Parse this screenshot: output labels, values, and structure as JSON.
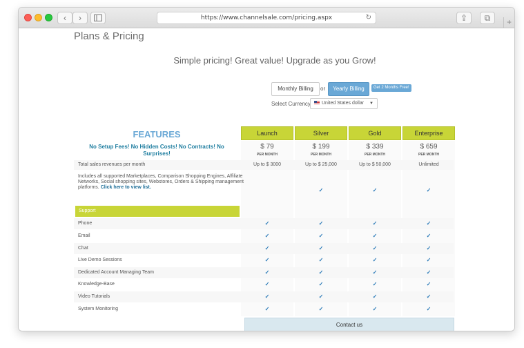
{
  "browser": {
    "url": "https://www.channelsale.com/pricing.aspx",
    "back_glyph": "‹",
    "forward_glyph": "›",
    "reload_glyph": "↻",
    "share_glyph": "⇪",
    "tabs_glyph": "⧉",
    "new_tab_glyph": "+"
  },
  "page": {
    "title": "Plans & Pricing",
    "tagline": "Simple pricing! Great value! Upgrade as you Grow!"
  },
  "billing": {
    "monthly_label": "Monthly Billing",
    "or_label": "or",
    "yearly_label": "Yearly Billing",
    "promo_label": "Get 2 Months Free!",
    "currency_label": "Select Currency",
    "currency_value": "United States dollar"
  },
  "features": {
    "heading": "FEATURES",
    "no_fees": "No Setup Fees! No Hidden Costs! No Contracts! No Surprises!"
  },
  "plans": [
    {
      "name": "Launch",
      "price": "$ 79",
      "period": "PER MONTH",
      "revenue": "Up to $ 3000"
    },
    {
      "name": "Silver",
      "price": "$ 199",
      "period": "PER MONTH",
      "revenue": "Up to $ 25,000"
    },
    {
      "name": "Gold",
      "price": "$ 339",
      "period": "PER MONTH",
      "revenue": "Up to $ 50,000"
    },
    {
      "name": "Enterprise",
      "price": "$ 659",
      "period": "PER MONTH",
      "revenue": "Unlimited"
    }
  ],
  "rows": {
    "revenue_label": "Total sales revenues per month",
    "marketplaces_label": "Includes all supported Marketplaces, Comparison Shopping Engines, Affiliate Networks, Social shopping sites, Webstores, Orders & Shipping management platforms.",
    "marketplaces_link": "Click here to view list.",
    "support_heading": "Support",
    "support_items": [
      "Phone",
      "Email",
      "Chat",
      "Live Demo Sessions",
      "Dedicated Account Managing Team",
      "Knowledge-Base",
      "Video Tutorials",
      "System Monitoring"
    ]
  },
  "check_glyph": "✓",
  "contact_label": "Contact us",
  "colors": {
    "accent_green": "#c8d537",
    "accent_blue": "#6aa8d6",
    "link_blue": "#1f7ea0"
  }
}
